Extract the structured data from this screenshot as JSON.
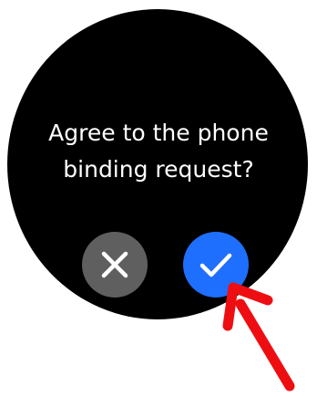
{
  "dialog": {
    "message": "Agree to the phone binding request?"
  },
  "buttons": {
    "decline_icon": "close-icon",
    "accept_icon": "check-icon"
  },
  "colors": {
    "decline": "#5f5f5f",
    "accept": "#1f6fff",
    "annotation_arrow": "#ee0e12"
  },
  "annotation": {
    "icon": "red-arrow-icon"
  }
}
